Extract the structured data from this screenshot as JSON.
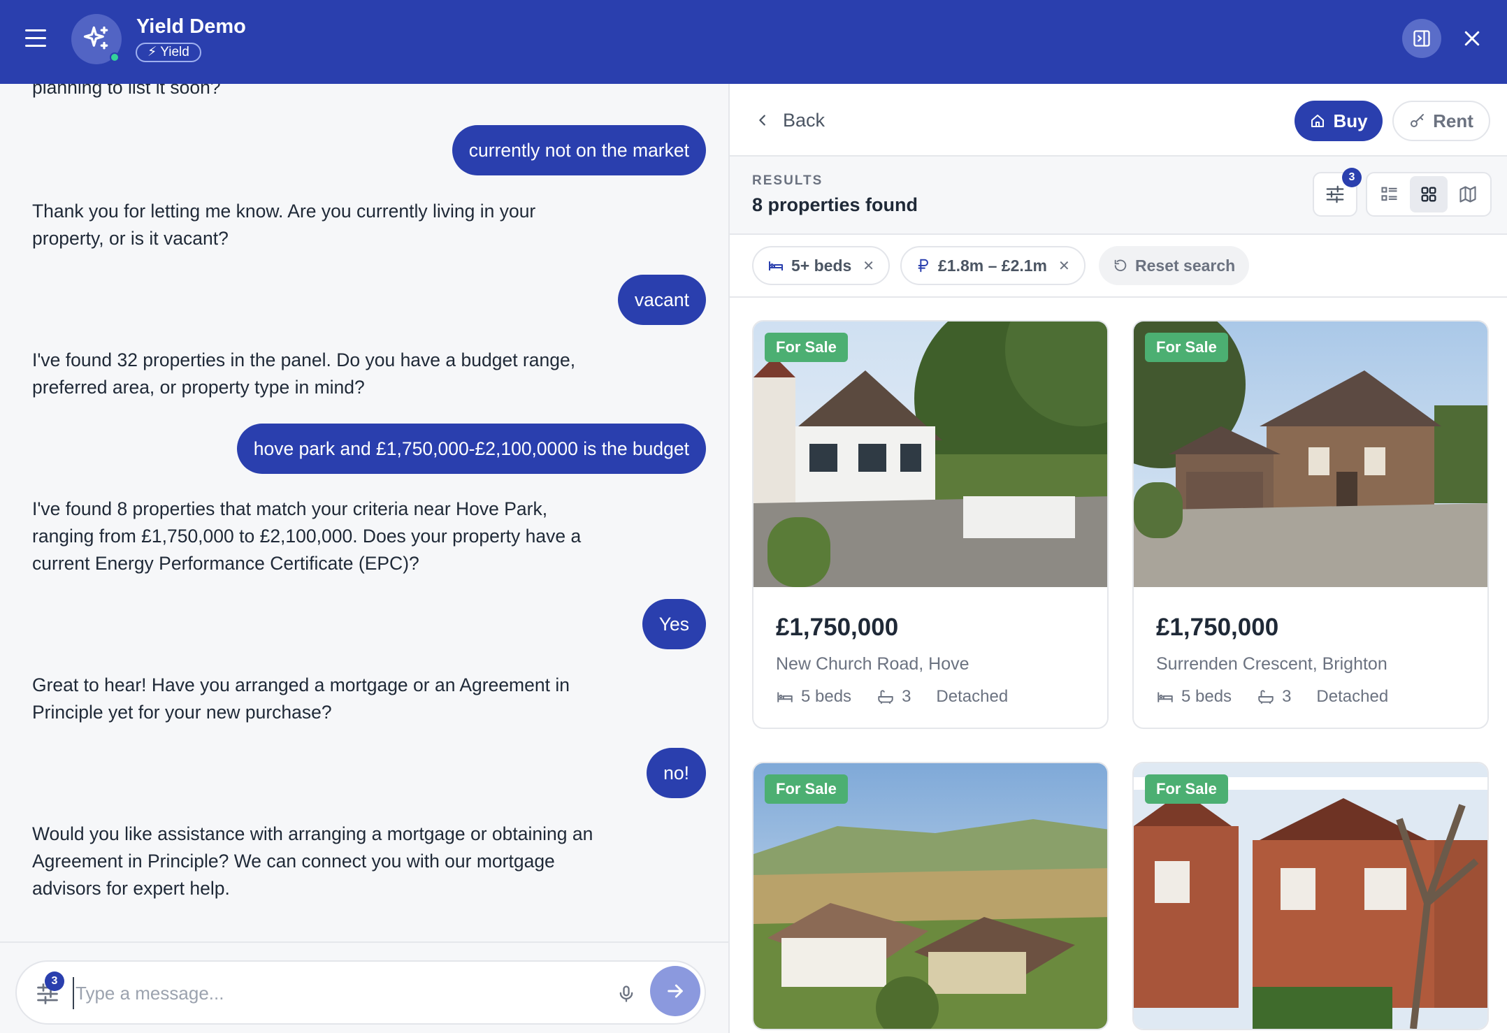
{
  "app": {
    "title": "Yield Demo",
    "badge": "⚡ Yield",
    "brand_color": "#2a3fae"
  },
  "chat": {
    "messages": [
      {
        "role": "bot",
        "text": "planning to list it soon?"
      },
      {
        "role": "user",
        "text": "currently not on the market"
      },
      {
        "role": "bot",
        "text": "Thank you for letting me know. Are you currently living in your property, or is it vacant?"
      },
      {
        "role": "user",
        "text": "vacant"
      },
      {
        "role": "bot",
        "text": "I've found 32 properties in the panel. Do you have a budget range, preferred area, or property type in mind?"
      },
      {
        "role": "user",
        "text": "hove park and £1,750,000-£2,100,0000 is the budget"
      },
      {
        "role": "bot",
        "text": "I've found 8 properties that match your criteria near Hove Park, ranging from £1,750,000 to £2,100,000. Does your property have a current Energy Performance Certificate (EPC)?"
      },
      {
        "role": "user",
        "text": "Yes"
      },
      {
        "role": "bot",
        "text": "Great to hear! Have you arranged a mortgage or an Agreement in Principle yet for your new purchase?"
      },
      {
        "role": "user",
        "text": "no!"
      },
      {
        "role": "bot",
        "text": "Would you like assistance with arranging a mortgage or obtaining an Agreement in Principle? We can connect you with our mortgage advisors for expert help."
      }
    ],
    "composer": {
      "placeholder": "Type a message...",
      "filter_count": "3"
    }
  },
  "panel": {
    "back_label": "Back",
    "buy_label": "Buy",
    "rent_label": "Rent",
    "results_label": "RESULTS",
    "results_count": "8 properties found",
    "filter_count": "3",
    "chips": [
      {
        "icon": "bed-icon",
        "label": "5+ beds"
      },
      {
        "icon": "currency-icon",
        "label": "£1.8m – £2.1m"
      }
    ],
    "reset_label": "Reset search",
    "listings": [
      {
        "tag": "For Sale",
        "price": "£1,750,000",
        "address": "New Church Road, Hove",
        "beds": "5 beds",
        "baths": "3",
        "type": "Detached"
      },
      {
        "tag": "For Sale",
        "price": "£1,750,000",
        "address": "Surrenden Crescent, Brighton",
        "beds": "5 beds",
        "baths": "3",
        "type": "Detached"
      },
      {
        "tag": "For Sale"
      },
      {
        "tag": "For Sale"
      }
    ]
  }
}
